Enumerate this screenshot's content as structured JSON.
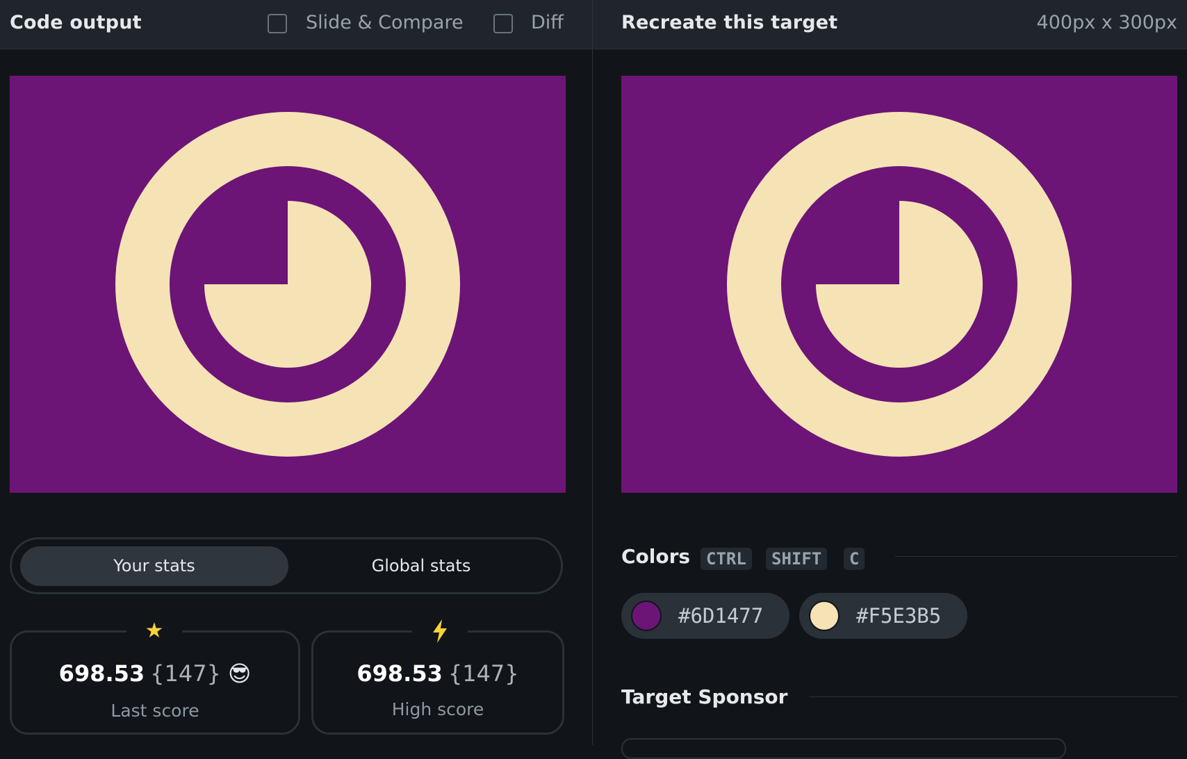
{
  "left_panel": {
    "title": "Code output",
    "slide_compare_label": "Slide & Compare",
    "diff_label": "Diff"
  },
  "right_panel": {
    "title": "Recreate this target",
    "dimensions": "400px x 300px"
  },
  "colors": {
    "background": "#6D1477",
    "foreground": "#F5E3B5"
  },
  "stats": {
    "tabs": [
      "Your stats",
      "Global stats"
    ],
    "last": {
      "icon": "star-icon",
      "value": "698.53",
      "count": "{147}",
      "emoji": "😎",
      "label": "Last score"
    },
    "high": {
      "icon": "lightning-icon",
      "value": "698.53",
      "count": "{147}",
      "label": "High score"
    }
  },
  "color_section": {
    "title": "Colors",
    "shortcut": [
      "CTRL",
      "SHIFT",
      "C"
    ],
    "swatches": [
      {
        "hex": "#6D1477"
      },
      {
        "hex": "#F5E3B5"
      }
    ]
  },
  "sponsor": {
    "title": "Target Sponsor"
  }
}
